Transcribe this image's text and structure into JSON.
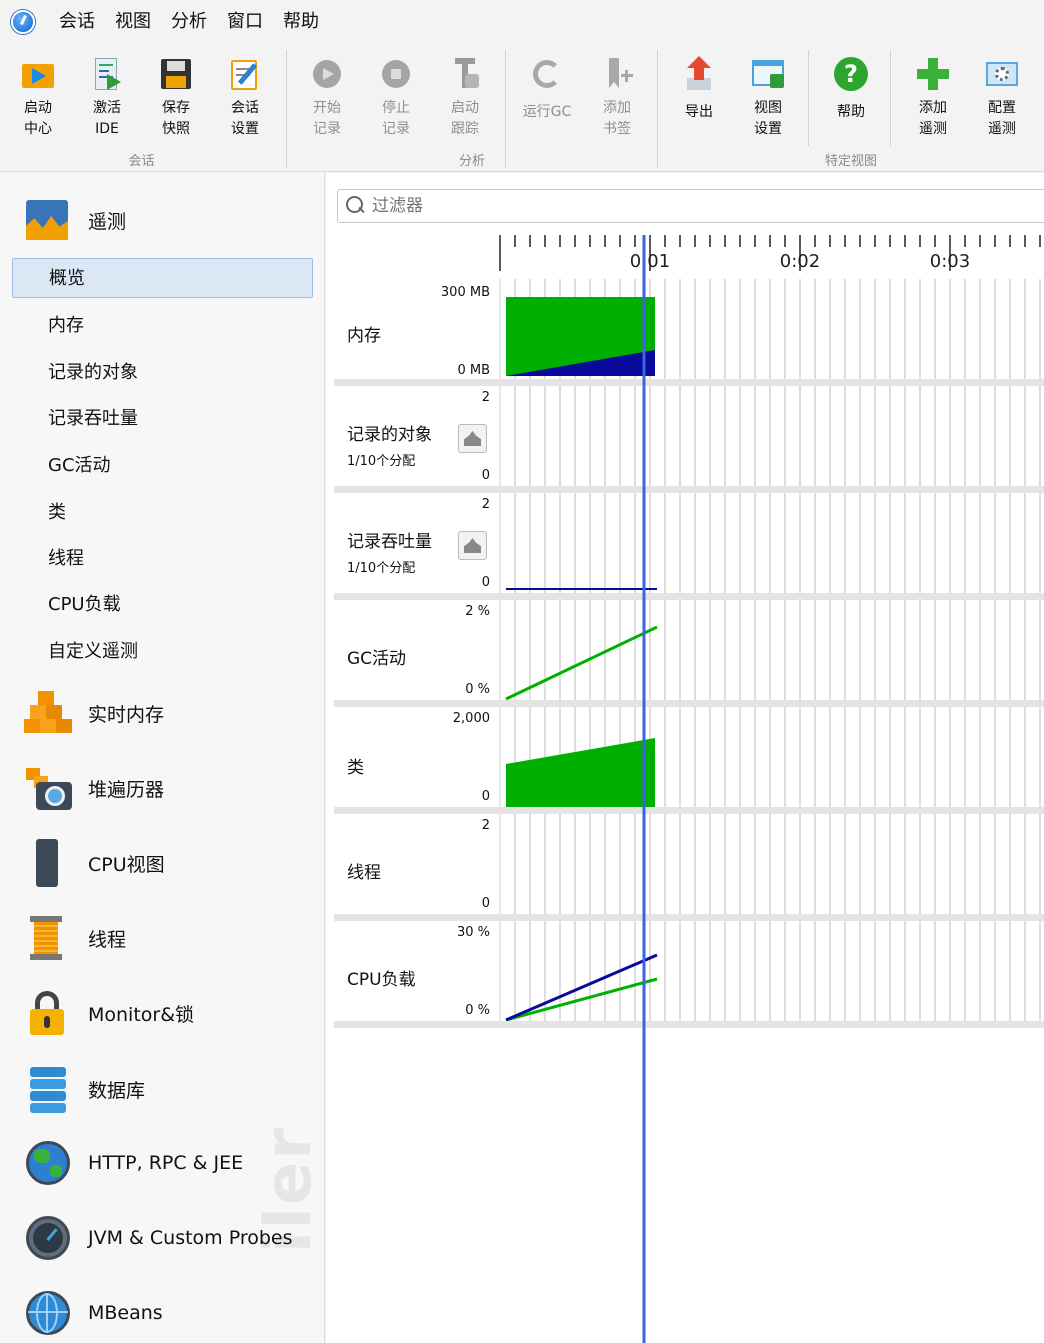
{
  "menu": [
    "会话",
    "视图",
    "分析",
    "窗口",
    "帮助"
  ],
  "toolbar": {
    "buttons": [
      {
        "label": "启动\n中心",
        "icon": "start-center-icon"
      },
      {
        "label": "激活\nIDE",
        "icon": "activate-ide-icon"
      },
      {
        "label": "保存\n快照",
        "icon": "save-snapshot-icon"
      },
      {
        "label": "会话\n设置",
        "icon": "session-settings-icon"
      },
      {
        "label": "开始\n记录",
        "icon": "start-recording-icon"
      },
      {
        "label": "停止\n记录",
        "icon": "stop-recording-icon"
      },
      {
        "label": "启动\n跟踪",
        "icon": "start-tracking-icon"
      },
      {
        "label": "运行GC",
        "icon": "run-gc-icon"
      },
      {
        "label": "添加\n书签",
        "icon": "add-bookmark-icon"
      },
      {
        "label": "导出",
        "icon": "export-icon"
      },
      {
        "label": "视图\n设置",
        "icon": "view-settings-icon"
      },
      {
        "label": "帮助",
        "icon": "help-icon"
      },
      {
        "label": "添加\n遥测",
        "icon": "add-telemetry-icon"
      },
      {
        "label": "配置\n遥测",
        "icon": "configure-telemetry-icon"
      }
    ],
    "groups": [
      "会话",
      "分析",
      "特定视图"
    ]
  },
  "sidebar": {
    "telemetry_label": "遥测",
    "sub_items": [
      "概览",
      "内存",
      "记录的对象",
      "记录吞吐量",
      "GC活动",
      "类",
      "线程",
      "CPU负载",
      "自定义遥测"
    ],
    "selected_index": 0,
    "sections": [
      {
        "label": "实时内存",
        "icon": "live-memory-icon"
      },
      {
        "label": "堆遍历器",
        "icon": "heap-walker-icon"
      },
      {
        "label": "CPU视图",
        "icon": "cpu-views-icon"
      },
      {
        "label": "线程",
        "icon": "threads-icon"
      },
      {
        "label": "Monitor&锁",
        "icon": "lock-icon"
      },
      {
        "label": "数据库",
        "icon": "database-icon"
      },
      {
        "label": "HTTP, RPC & JEE",
        "icon": "globe-icon"
      },
      {
        "label": "JVM & Custom Probes",
        "icon": "gauge-icon"
      },
      {
        "label": "MBeans",
        "icon": "mbeans-globe-icon"
      }
    ]
  },
  "filter": {
    "placeholder": "过滤器"
  },
  "timeline": {
    "ticks": [
      "0:01",
      "0:02",
      "0:03"
    ],
    "current_time_fraction": 0.96,
    "rows": [
      {
        "name": "内存",
        "max": "300 MB",
        "min": "0 MB"
      },
      {
        "name": "记录的对象",
        "sub": "1/10个分配",
        "max": "2",
        "min": "0"
      },
      {
        "name": "记录吞吐量",
        "sub": "1/10个分配",
        "max": "2",
        "min": "0"
      },
      {
        "name": "GC活动",
        "max": "2 %",
        "min": "0 %"
      },
      {
        "name": "类",
        "max": "2,000",
        "min": "0"
      },
      {
        "name": "线程",
        "max": "2",
        "min": "0"
      },
      {
        "name": "CPU负载",
        "max": "30 %",
        "min": "0 %"
      }
    ]
  },
  "colors": {
    "green": "#00b000",
    "navy": "#0a0a9a",
    "cursor": "#3a64e0"
  }
}
